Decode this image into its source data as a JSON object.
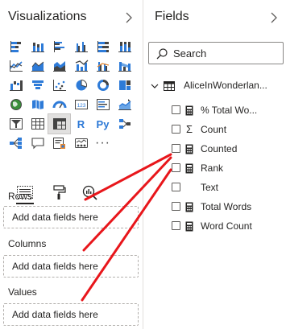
{
  "viz_pane": {
    "title": "Visualizations",
    "collapse_icon": "chevron-right-icon",
    "viz_icons": [
      "stacked-bar-chart-icon",
      "stacked-column-chart-icon",
      "clustered-bar-chart-icon",
      "clustered-column-chart-icon",
      "100-stacked-bar-chart-icon",
      "100-stacked-column-chart-icon",
      "line-chart-icon",
      "area-chart-icon",
      "stacked-area-chart-icon",
      "line-and-stacked-column-chart-icon",
      "line-and-clustered-column-chart-icon",
      "ribbon-chart-icon",
      "waterfall-chart-icon",
      "funnel-chart-icon",
      "scatter-chart-icon",
      "pie-chart-icon",
      "donut-chart-icon",
      "treemap-icon",
      "map-icon",
      "filled-map-icon",
      "gauge-icon",
      "card-icon",
      "multi-row-card-icon",
      "kpi-icon",
      "slicer-icon",
      "table-visual-icon",
      "matrix-icon",
      "r-script-visual-icon",
      "python-visual-icon",
      "key-influencers-icon",
      "decomposition-tree-icon",
      "qa-icon",
      "smart-narrative-icon",
      "paginated-report-icon",
      "more-visuals-icon"
    ],
    "selected_viz": "matrix-icon",
    "r_label": "R",
    "py_label": "Py",
    "tools": [
      "fields-well-icon",
      "format-paint-roller-icon",
      "analytics-magnifier-icon"
    ],
    "wells": [
      {
        "label": "Rows",
        "placeholder": "Add data fields here"
      },
      {
        "label": "Columns",
        "placeholder": "Add data fields here"
      },
      {
        "label": "Values",
        "placeholder": "Add data fields here"
      }
    ]
  },
  "fields_pane": {
    "title": "Fields",
    "collapse_icon": "chevron-right-icon",
    "search_placeholder": "Search",
    "table_name": "AliceInWonderlan...",
    "fields": [
      {
        "name": "% Total Wo...",
        "type_icon": "calculator-icon"
      },
      {
        "name": "Count",
        "type_icon": "sigma-icon"
      },
      {
        "name": "Counted",
        "type_icon": "calculator-icon"
      },
      {
        "name": "Rank",
        "type_icon": "calculator-icon"
      },
      {
        "name": "Text",
        "type_icon": "none"
      },
      {
        "name": "Total Words",
        "type_icon": "calculator-icon"
      },
      {
        "name": "Word Count",
        "type_icon": "calculator-icon"
      }
    ]
  },
  "colors": {
    "annotation_red": "#e8161b",
    "accent_blue": "#2b78d6",
    "viz_blue": "#2e7bd8",
    "viz_orange": "#e8872d",
    "text": "#252423"
  }
}
